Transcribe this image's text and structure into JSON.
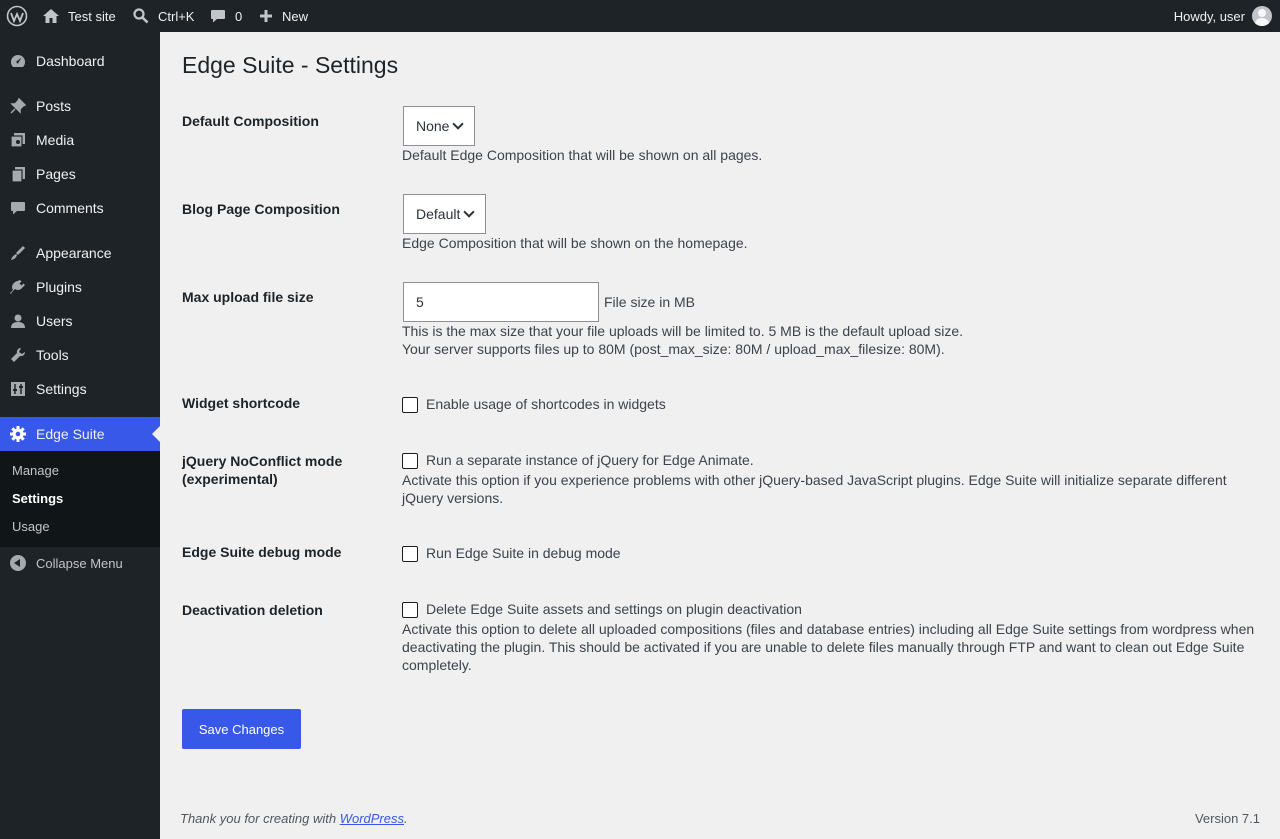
{
  "adminbar": {
    "site_name": "Test site",
    "search_shortcut": "Ctrl+K",
    "comments_count": "0",
    "new_label": "New",
    "howdy": "Howdy, user"
  },
  "sidebar": {
    "items": [
      {
        "label": "Dashboard",
        "icon": "dashboard-icon"
      },
      {
        "label": "Posts",
        "icon": "pin-icon"
      },
      {
        "label": "Media",
        "icon": "media-icon"
      },
      {
        "label": "Pages",
        "icon": "pages-icon"
      },
      {
        "label": "Comments",
        "icon": "comment-icon"
      },
      {
        "label": "Appearance",
        "icon": "brush-icon"
      },
      {
        "label": "Plugins",
        "icon": "plug-icon"
      },
      {
        "label": "Users",
        "icon": "user-icon"
      },
      {
        "label": "Tools",
        "icon": "wrench-icon"
      },
      {
        "label": "Settings",
        "icon": "sliders-icon"
      },
      {
        "label": "Edge Suite",
        "icon": "gear-icon"
      }
    ],
    "submenu": [
      "Manage",
      "Settings",
      "Usage"
    ],
    "collapse": "Collapse Menu"
  },
  "page": {
    "title": "Edge Suite - Settings",
    "fields": {
      "default_composition": {
        "label": "Default Composition",
        "value": "None",
        "description": "Default Edge Composition that will be shown on all pages."
      },
      "blog_composition": {
        "label": "Blog Page Composition",
        "value": "Default",
        "description": "Edge Composition that will be shown on the homepage."
      },
      "max_upload": {
        "label": "Max upload file size",
        "value": "5",
        "unit": "File size in MB",
        "description1": "This is the max size that your file uploads will be limited to. 5 MB is the default upload size.",
        "description2": "Your server supports files up to 80M (post_max_size: 80M / upload_max_filesize: 80M)."
      },
      "widget_shortcode": {
        "label": "Widget shortcode",
        "checkbox": "Enable usage of shortcodes in widgets"
      },
      "jquery_noconflict": {
        "label": "jQuery NoConflict mode (experimental)",
        "checkbox": "Run a separate instance of jQuery for Edge Animate.",
        "description": "Activate this option if you experience problems with other jQuery-based JavaScript plugins. Edge Suite will initialize separate different jQuery versions."
      },
      "debug_mode": {
        "label": "Edge Suite debug mode",
        "checkbox": "Run Edge Suite in debug mode"
      },
      "deactivation": {
        "label": "Deactivation deletion",
        "checkbox": "Delete Edge Suite assets and settings on plugin deactivation",
        "description": "Activate this option to delete all uploaded compositions (files and database entries) including all Edge Suite settings from wordpress when deactivating the plugin. This should be activated if you are unable to delete files manually through FTP and want to clean out Edge Suite completely."
      }
    },
    "save_label": "Save Changes"
  },
  "footer": {
    "thanks_prefix": "Thank you for creating with ",
    "thanks_link": "WordPress",
    "thanks_suffix": ".",
    "version": "Version 7.1"
  },
  "colors": {
    "accent": "#3858e9",
    "sidebar_bg": "#1d2327",
    "content_bg": "#f0f0f1"
  }
}
